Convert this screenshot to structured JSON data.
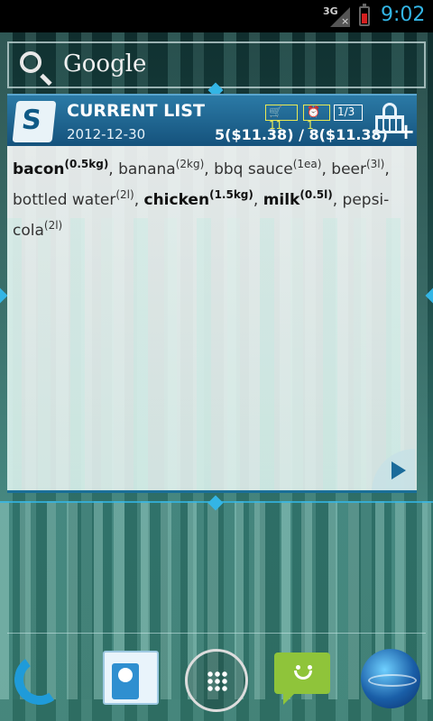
{
  "status_bar": {
    "network": "3G",
    "time": "9:02"
  },
  "search": {
    "placeholder": "Google"
  },
  "widget": {
    "title": "CURRENT LIST",
    "date": "2012-12-30",
    "badge_items": "11",
    "badge_alarm": "1",
    "badge_page": "1/3",
    "totals": "5($11.38) / 8($11.38)",
    "items": [
      {
        "name": "bacon",
        "qty": "(0.5kg)",
        "bold": true,
        "sep": ", "
      },
      {
        "name": "banana",
        "qty": "(2kg)",
        "bold": false,
        "sep": ", "
      },
      {
        "name": "bbq sauce",
        "qty": "(1ea)",
        "bold": false,
        "sep": ", "
      },
      {
        "name": "beer",
        "qty": "(3l)",
        "bold": false,
        "sep": ", "
      },
      {
        "name": "bottled water",
        "qty": "(2l)",
        "bold": false,
        "sep": ", "
      },
      {
        "name": "chicken",
        "qty": "(1.5kg)",
        "bold": true,
        "sep": ", "
      },
      {
        "name": "milk",
        "qty": "(0.5l)",
        "bold": true,
        "sep": ", "
      },
      {
        "name": "pepsi-cola",
        "qty": "(2l)",
        "bold": false,
        "sep": ""
      }
    ]
  },
  "dock": {
    "apps": [
      "phone",
      "people",
      "all-apps",
      "messaging",
      "browser"
    ]
  },
  "colors": {
    "accent": "#33b5e5",
    "widget_header": "#15527c",
    "badge_yellow": "#e9ea55"
  }
}
